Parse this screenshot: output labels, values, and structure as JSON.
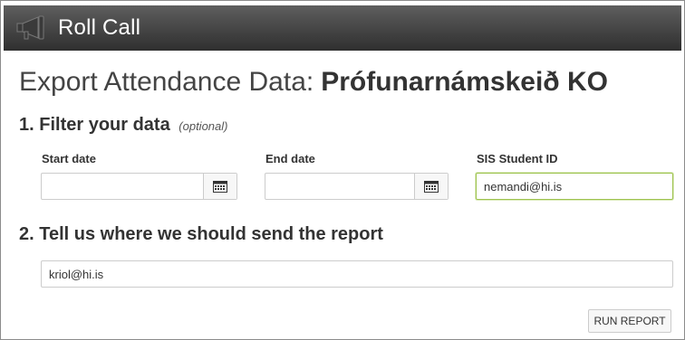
{
  "app": {
    "title": "Roll Call",
    "logo_icon": "megaphone-icon"
  },
  "page": {
    "heading_prefix": "Export Attendance Data:",
    "course_name": "Prófunarnámskeið KO"
  },
  "filter": {
    "step_title": "1. Filter your data",
    "step_hint": "(optional)",
    "start_date": {
      "label": "Start date",
      "value": "",
      "icon": "calendar-icon"
    },
    "end_date": {
      "label": "End date",
      "value": "",
      "icon": "calendar-icon"
    },
    "sis_student_id": {
      "label": "SIS Student ID",
      "value": "nemandi@hi.is"
    }
  },
  "report": {
    "step_title": "2. Tell us where we should send the report",
    "email_value": "kriol@hi.is",
    "run_button_label": "RUN REPORT"
  },
  "colors": {
    "titlebar_top": "#5e5e5e",
    "titlebar_bottom": "#2f2f2f",
    "focus_border": "#9dc24d"
  }
}
